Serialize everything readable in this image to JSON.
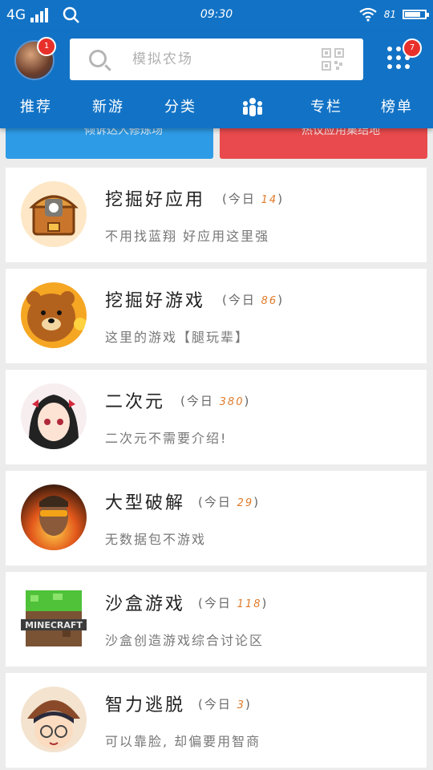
{
  "status_bar": {
    "network": "4G",
    "time": "09:30",
    "battery_level": "81",
    "battery_fraction": 0.81,
    "icons": [
      "signal-icon",
      "search-icon",
      "wifi-icon",
      "battery-icon"
    ]
  },
  "header": {
    "avatar_badge": "1",
    "search_placeholder": "模拟农场",
    "menu_badge": "7",
    "tabs": [
      "推荐",
      "新游",
      "分类",
      "",
      "专栏",
      "榜单"
    ],
    "active_tab_icon": "community-icon"
  },
  "banners": [
    {
      "text": "倾诉达人修炼场",
      "color": "#2e9be6"
    },
    {
      "text": "热议应用集结地",
      "color": "#e84a4d"
    }
  ],
  "forums": [
    {
      "title": "挖掘好应用",
      "today_label": "今日",
      "count": "14",
      "desc": "不用找蓝翔 好应用这里强",
      "icon": "treasure-chest-icon"
    },
    {
      "title": "挖掘好游戏",
      "today_label": "今日",
      "count": "86",
      "desc": "这里的游戏【腿玩辈】",
      "icon": "brown-bear-icon"
    },
    {
      "title": "二次元",
      "today_label": "今日",
      "count": "380",
      "desc": "二次元不需要介绍!",
      "icon": "anime-girl-icon"
    },
    {
      "title": "大型破解",
      "today_label": "今日",
      "count": "29",
      "desc": "无数据包不游戏",
      "icon": "soldier-icon"
    },
    {
      "title": "沙盒游戏",
      "today_label": "今日",
      "count": "118",
      "desc": "沙盒创造游戏综合讨论区",
      "icon": "minecraft-icon"
    },
    {
      "title": "智力逃脱",
      "today_label": "今日",
      "count": "3",
      "desc": "可以靠脸, 却偏要用智商",
      "icon": "detective-icon"
    }
  ],
  "colors": {
    "primary": "#1273c6",
    "count": "#e07a2a",
    "badge": "#e8302b"
  }
}
